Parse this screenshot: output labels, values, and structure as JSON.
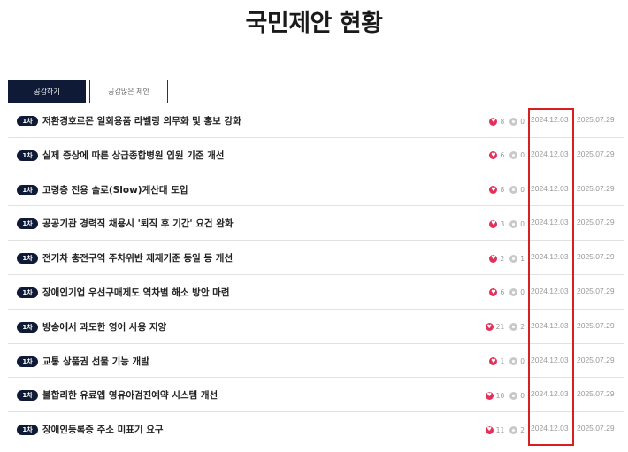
{
  "page": {
    "title": "국민제안 현황"
  },
  "tabs": [
    {
      "label": "공감하기",
      "active": true
    },
    {
      "label": "공감많은 제안",
      "active": false
    }
  ],
  "colors": {
    "navy": "#0f1a36",
    "heart": "#e5315a",
    "highlight": "#d81f1f"
  },
  "rows": [
    {
      "badge": "1차",
      "title": "저환경호르몬 일회용품 라벨링 의무화 및 홍보 강화",
      "likes": "8",
      "dislikes": "0",
      "start": "2024.12.03",
      "end": "2025.07.29"
    },
    {
      "badge": "1차",
      "title": "실제 증상에 따른 상급종합병원 입원 기준 개선",
      "likes": "6",
      "dislikes": "0",
      "start": "2024.12.03",
      "end": "2025.07.29"
    },
    {
      "badge": "1차",
      "title": "고령층 전용 슬로(Slow)계산대 도입",
      "likes": "8",
      "dislikes": "0",
      "start": "2024.12.03",
      "end": "2025.07.29"
    },
    {
      "badge": "1차",
      "title": "공공기관 경력직 채용시 '퇴직 후 기간' 요건 완화",
      "likes": "3",
      "dislikes": "0",
      "start": "2024.12.03",
      "end": "2025.07.29"
    },
    {
      "badge": "1차",
      "title": "전기차 충전구역 주차위반 제재기준 동일 등 개선",
      "likes": "2",
      "dislikes": "1",
      "start": "2024.12.03",
      "end": "2025.07.29"
    },
    {
      "badge": "1차",
      "title": "장애인기업 우선구매제도 역차별 해소 방안 마련",
      "likes": "6",
      "dislikes": "0",
      "start": "2024.12.03",
      "end": "2025.07.29"
    },
    {
      "badge": "1차",
      "title": "방송에서 과도한 영어 사용 지양",
      "likes": "21",
      "dislikes": "2",
      "start": "2024.12.03",
      "end": "2025.07.29"
    },
    {
      "badge": "1차",
      "title": "교통 상품권 선물 기능 개발",
      "likes": "1",
      "dislikes": "0",
      "start": "2024.12.03",
      "end": "2025.07.29"
    },
    {
      "badge": "1차",
      "title": "불합리한 유료앱 영유아검진예약 시스템 개선",
      "likes": "10",
      "dislikes": "0",
      "start": "2024.12.03",
      "end": "2025.07.29"
    },
    {
      "badge": "1차",
      "title": "장애인등록증 주소 미표기 요구",
      "likes": "11",
      "dislikes": "2",
      "start": "2024.12.03",
      "end": "2025.07.29"
    }
  ]
}
